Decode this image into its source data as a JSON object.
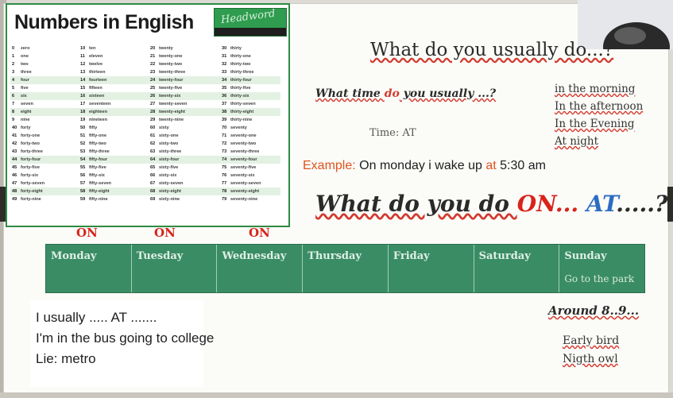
{
  "numbers_chart": {
    "title": "Numbers in English",
    "logo_text": "Headword",
    "columns": [
      [
        "0 zero",
        "1 one",
        "2 two",
        "3 three",
        "4 four",
        "5 five",
        "6 six",
        "7 seven",
        "8 eight",
        "9 nine",
        "40 forty",
        "41 forty-one",
        "42 forty-two",
        "43 forty-three",
        "44 forty-four",
        "45 forty-five",
        "46 forty-six",
        "47 forty-seven",
        "48 forty-eight",
        "49 forty-nine"
      ],
      [
        "10 ten",
        "11 eleven",
        "12 twelve",
        "13 thirteen",
        "14 fourteen",
        "15 fifteen",
        "16 sixteen",
        "17 seventeen",
        "18 eighteen",
        "19 nineteen",
        "50 fifty",
        "51 fifty-one",
        "52 fifty-two",
        "53 fifty-three",
        "54 fifty-four",
        "55 fifty-five",
        "56 fifty-six",
        "57 fifty-seven",
        "58 fifty-eight",
        "59 fifty-nine"
      ],
      [
        "20 twenty",
        "21 twenty-one",
        "22 twenty-two",
        "23 twenty-three",
        "24 twenty-four",
        "25 twenty-five",
        "26 twenty-six",
        "27 twenty-seven",
        "28 twenty-eight",
        "29 twenty-nine",
        "60 sixty",
        "61 sixty-one",
        "62 sixty-two",
        "63 sixty-three",
        "64 sixty-four",
        "65 sixty-five",
        "66 sixty-six",
        "67 sixty-seven",
        "68 sixty-eight",
        "69 sixty-nine"
      ],
      [
        "30 thirty",
        "31 thirty-one",
        "32 thirty-two",
        "33 thirty-three",
        "34 thirty-four",
        "35 thirty-five",
        "36 thirty-six",
        "37 thirty-seven",
        "38 thirty-eight",
        "39 thirty-nine",
        "70 seventy",
        "71 seventy-one",
        "72 seventy-two",
        "73 seventy-three",
        "74 seventy-four",
        "75 seventy-five",
        "76 seventy-six",
        "77 seventy-seven",
        "78 seventy-eight",
        "79 seventy-nine"
      ]
    ]
  },
  "whiteboard": {
    "question_title": "What do you usually do...?",
    "time_question": {
      "before": "What time ",
      "do": "do",
      "after": " you usually ...?"
    },
    "time_answer": "Time: AT",
    "times_of_day": [
      "in the morning",
      "In the afternoon",
      "In the Evening",
      "At night"
    ],
    "example": {
      "label": "Example:",
      "text_before": " On monday i wake up ",
      "at": "at",
      "text_after": " 5:30 am"
    },
    "big_question": {
      "before": "What do you do ",
      "on": "ON...",
      "at": "AT",
      "after": ".....?"
    },
    "on_marks": [
      "ON",
      "ON",
      "ON"
    ],
    "days": [
      {
        "name": "Monday",
        "note": ""
      },
      {
        "name": "Tuesday",
        "note": ""
      },
      {
        "name": "Wednesday",
        "note": ""
      },
      {
        "name": "Thursday",
        "note": ""
      },
      {
        "name": "Friday",
        "note": ""
      },
      {
        "name": "Saturday",
        "note": ""
      },
      {
        "name": "Sunday",
        "note": "Go to the park"
      }
    ],
    "around": "Around 8..9...",
    "early_bird": "Early bird",
    "night_owl": "Nigth owl"
  },
  "notes": {
    "lines": [
      "I usually ..... AT .......",
      "I'm in the bus going to college",
      "Lie: metro"
    ]
  },
  "colors": {
    "table_green": "#3a8c65",
    "chart_green": "#2e8b45",
    "accent_red": "#d8231a",
    "accent_blue": "#2c6cc2",
    "example_orange": "#e0531f"
  }
}
